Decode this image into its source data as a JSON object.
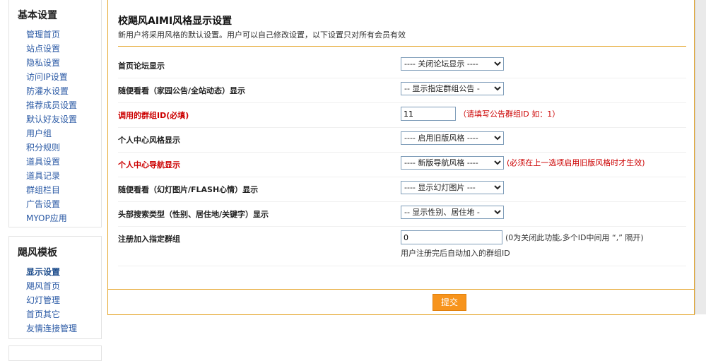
{
  "sidebar": {
    "section1": {
      "title": "基本设置",
      "items": [
        "管理首页",
        "站点设置",
        "隐私设置",
        "访问IP设置",
        "防灌水设置",
        "推荐成员设置",
        "默认好友设置",
        "用户组",
        "积分规则",
        "道具设置",
        "道具记录",
        "群组栏目",
        "广告设置",
        "MYOP应用"
      ]
    },
    "section2": {
      "title": "飓风模板",
      "items": [
        "显示设置",
        "飓风首页",
        "幻灯管理",
        "首页其它",
        "友情连接管理"
      ]
    }
  },
  "main": {
    "title": "校飓风AIMI风格显示设置",
    "subtitle": "新用户将采用风格的默认设置。用户可以自己修改设置，以下设置只对所有会员有效",
    "rows": [
      {
        "label": "首页论坛显示",
        "select": "---- 关闭论坛显示 ----"
      },
      {
        "label": "随便看看（家园公告/全站动态）显示",
        "select": "-- 显示指定群组公告 -"
      },
      {
        "label": "调用的群组ID(必填)",
        "input": "11",
        "hint": "（请填写公告群组ID 如：1）"
      },
      {
        "label": "个人中心风格显示",
        "select": "---- 启用旧版风格 ----"
      },
      {
        "label": "个人中心导航显示",
        "select": "---- 新版导航风格 ----",
        "hint": "(必须在上一选项启用旧版风格时才生效)"
      },
      {
        "label": "随便看看（幻灯图片/FLASH心情）显示",
        "select": "---- 显示幻灯图片 ---"
      },
      {
        "label": "头部搜索类型（性别、居住地/关键字）显示",
        "select": "-- 显示性别、居住地 -"
      },
      {
        "label": "注册加入指定群组",
        "input": "0",
        "hint": "(0为关闭此功能,多个ID中间用 “,” 隔开)",
        "subhint": "用户注册完后自动加入的群组ID"
      }
    ],
    "submit_label": "提交"
  }
}
